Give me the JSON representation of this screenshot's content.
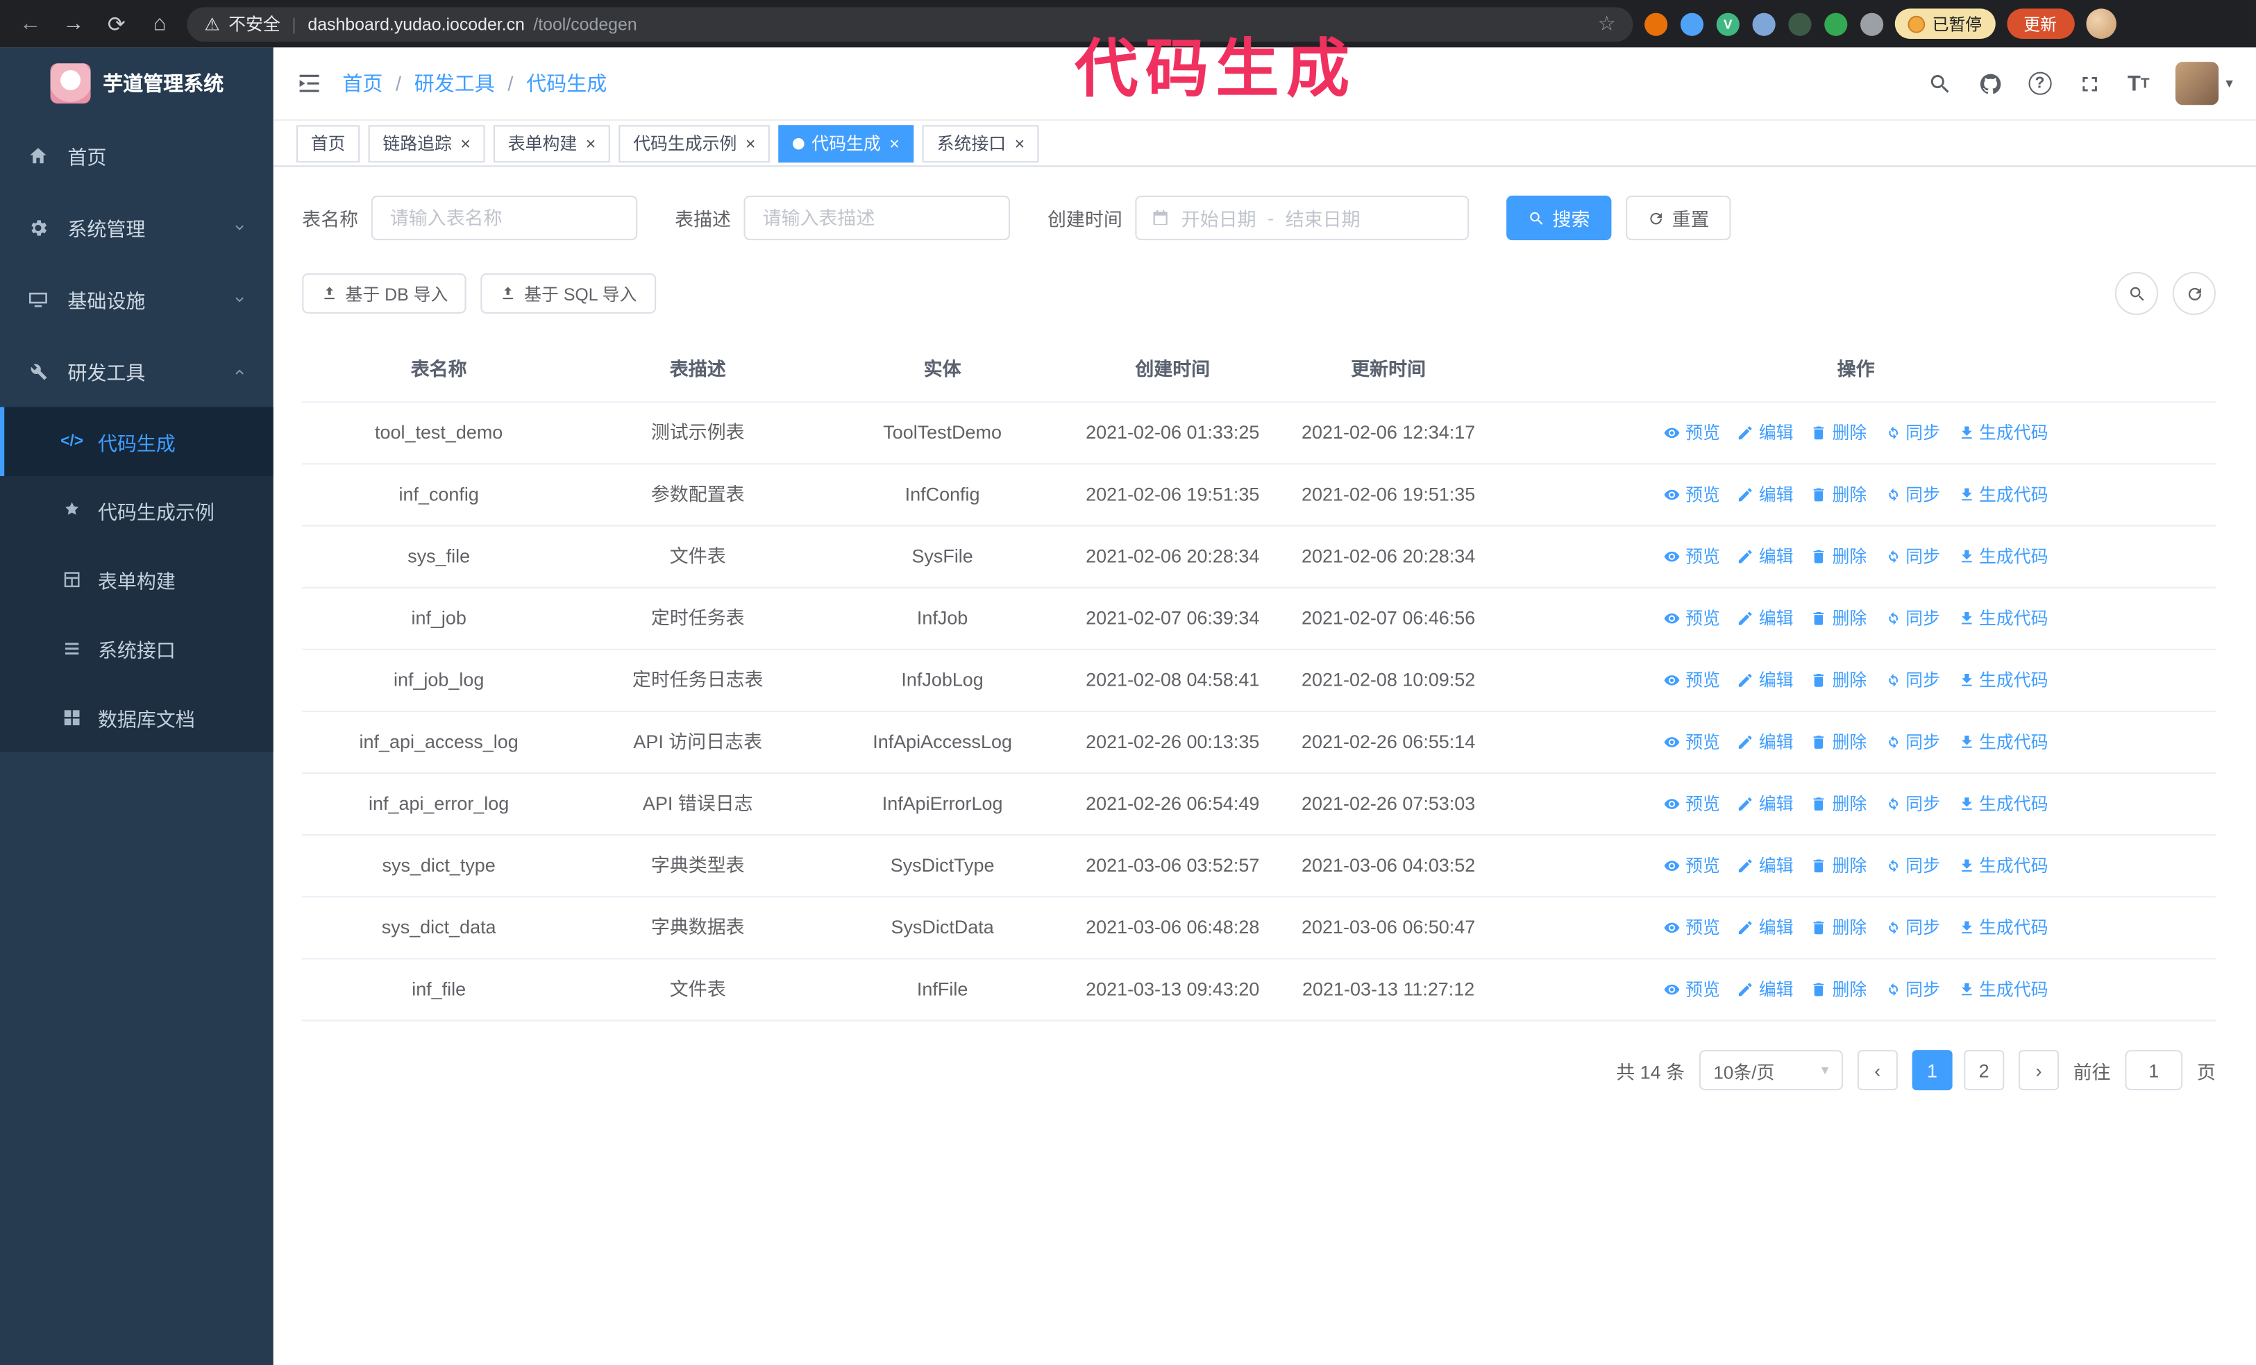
{
  "browser": {
    "not_secure": "不安全",
    "url_host": "dashboard.yudao.iocoder.cn",
    "url_path": "/tool/codegen",
    "paused_badge": "已暂停",
    "update_button": "更新",
    "extensions": [
      {
        "id": "extension-orange",
        "color": "#e8710a"
      },
      {
        "id": "extension-blue-drop",
        "color": "#4fa3f7"
      },
      {
        "id": "extension-vue-devtools",
        "color": "#41b883",
        "glyph": "V"
      },
      {
        "id": "extension-accounts",
        "color": "#7fa6d9"
      },
      {
        "id": "extension-dark-green",
        "color": "#3c5a46"
      },
      {
        "id": "extension-leaf",
        "color": "#34a853"
      },
      {
        "id": "extension-puzzle",
        "color": "#9aa0a6"
      }
    ]
  },
  "annotation": {
    "text": "代码生成"
  },
  "sidebar": {
    "logo_title": "芋道管理系统",
    "items": [
      {
        "id": "home",
        "label": "首页",
        "icon": "home"
      },
      {
        "id": "system",
        "label": "系统管理",
        "icon": "gear",
        "chevron": "down"
      },
      {
        "id": "infra",
        "label": "基础设施",
        "icon": "infra",
        "chevron": "down"
      },
      {
        "id": "devtools",
        "label": "研发工具",
        "icon": "tools",
        "chevron": "up",
        "expanded": true
      }
    ],
    "subitems": [
      {
        "id": "codegen",
        "label": "代码生成",
        "icon": "code",
        "active": true
      },
      {
        "id": "codegen-example",
        "label": "代码生成示例",
        "icon": "badge"
      },
      {
        "id": "form-builder",
        "label": "表单构建",
        "icon": "form"
      },
      {
        "id": "system-api",
        "label": "系统接口",
        "icon": "api"
      },
      {
        "id": "db-doc",
        "label": "数据库文档",
        "icon": "db"
      }
    ]
  },
  "header": {
    "breadcrumb": [
      "首页",
      "研发工具",
      "代码生成"
    ]
  },
  "tabs": [
    {
      "id": "home",
      "label": "首页",
      "closable": false,
      "active": false
    },
    {
      "id": "trace",
      "label": "链路追踪",
      "closable": true,
      "active": false
    },
    {
      "id": "form-builder",
      "label": "表单构建",
      "closable": true,
      "active": false
    },
    {
      "id": "codegen-example",
      "label": "代码生成示例",
      "closable": true,
      "active": false
    },
    {
      "id": "codegen",
      "label": "代码生成",
      "closable": true,
      "active": true
    },
    {
      "id": "system-api",
      "label": "系统接口",
      "closable": true,
      "active": false
    }
  ],
  "filters": {
    "table_name_label": "表名称",
    "table_name_placeholder": "请输入表名称",
    "table_desc_label": "表描述",
    "table_desc_placeholder": "请输入表描述",
    "create_time_label": "创建时间",
    "date_start_placeholder": "开始日期",
    "date_separator": "-",
    "date_end_placeholder": "结束日期",
    "search_button": "搜索",
    "reset_button": "重置"
  },
  "toolbar": {
    "import_db_button": "基于 DB 导入",
    "import_sql_button": "基于 SQL 导入"
  },
  "table": {
    "columns": [
      "表名称",
      "表描述",
      "实体",
      "创建时间",
      "更新时间",
      "操作"
    ],
    "rows": [
      {
        "name": "tool_test_demo",
        "desc": "测试示例表",
        "entity": "ToolTestDemo",
        "created": "2021-02-06 01:33:25",
        "updated": "2021-02-06 12:34:17"
      },
      {
        "name": "inf_config",
        "desc": "参数配置表",
        "entity": "InfConfig",
        "created": "2021-02-06 19:51:35",
        "updated": "2021-02-06 19:51:35"
      },
      {
        "name": "sys_file",
        "desc": "文件表",
        "entity": "SysFile",
        "created": "2021-02-06 20:28:34",
        "updated": "2021-02-06 20:28:34"
      },
      {
        "name": "inf_job",
        "desc": "定时任务表",
        "entity": "InfJob",
        "created": "2021-02-07 06:39:34",
        "updated": "2021-02-07 06:46:56"
      },
      {
        "name": "inf_job_log",
        "desc": "定时任务日志表",
        "entity": "InfJobLog",
        "created": "2021-02-08 04:58:41",
        "updated": "2021-02-08 10:09:52"
      },
      {
        "name": "inf_api_access_log",
        "desc": "API 访问日志表",
        "entity": "InfApiAccessLog",
        "created": "2021-02-26 00:13:35",
        "updated": "2021-02-26 06:55:14"
      },
      {
        "name": "inf_api_error_log",
        "desc": "API 错误日志",
        "entity": "InfApiErrorLog",
        "created": "2021-02-26 06:54:49",
        "updated": "2021-02-26 07:53:03"
      },
      {
        "name": "sys_dict_type",
        "desc": "字典类型表",
        "entity": "SysDictType",
        "created": "2021-03-06 03:52:57",
        "updated": "2021-03-06 04:03:52"
      },
      {
        "name": "sys_dict_data",
        "desc": "字典数据表",
        "entity": "SysDictData",
        "created": "2021-03-06 06:48:28",
        "updated": "2021-03-06 06:50:47"
      },
      {
        "name": "inf_file",
        "desc": "文件表",
        "entity": "InfFile",
        "created": "2021-03-13 09:43:20",
        "updated": "2021-03-13 11:27:12"
      }
    ],
    "ops": [
      {
        "id": "preview",
        "label": "预览",
        "icon": "eye"
      },
      {
        "id": "edit",
        "label": "编辑",
        "icon": "edit"
      },
      {
        "id": "delete",
        "label": "删除",
        "icon": "trash"
      },
      {
        "id": "sync",
        "label": "同步",
        "icon": "sync"
      },
      {
        "id": "generate",
        "label": "生成代码",
        "icon": "download"
      }
    ]
  },
  "pagination": {
    "total": "共 14 条",
    "page_size": "10条/页",
    "pages": [
      "1",
      "2"
    ],
    "active_page": "1",
    "prev": "‹",
    "next": "›",
    "goto_label": "前往",
    "goto_value": "1",
    "goto_suffix": "页"
  },
  "colors": {
    "primary": "#409eff",
    "annotation": "#f0305f",
    "sidebar_bg": "#263b50",
    "submenu_bg": "#1d2f40",
    "chrome_bg": "#202124",
    "update_bg": "#d9512c",
    "paused_bg": "#f6e2a8"
  }
}
